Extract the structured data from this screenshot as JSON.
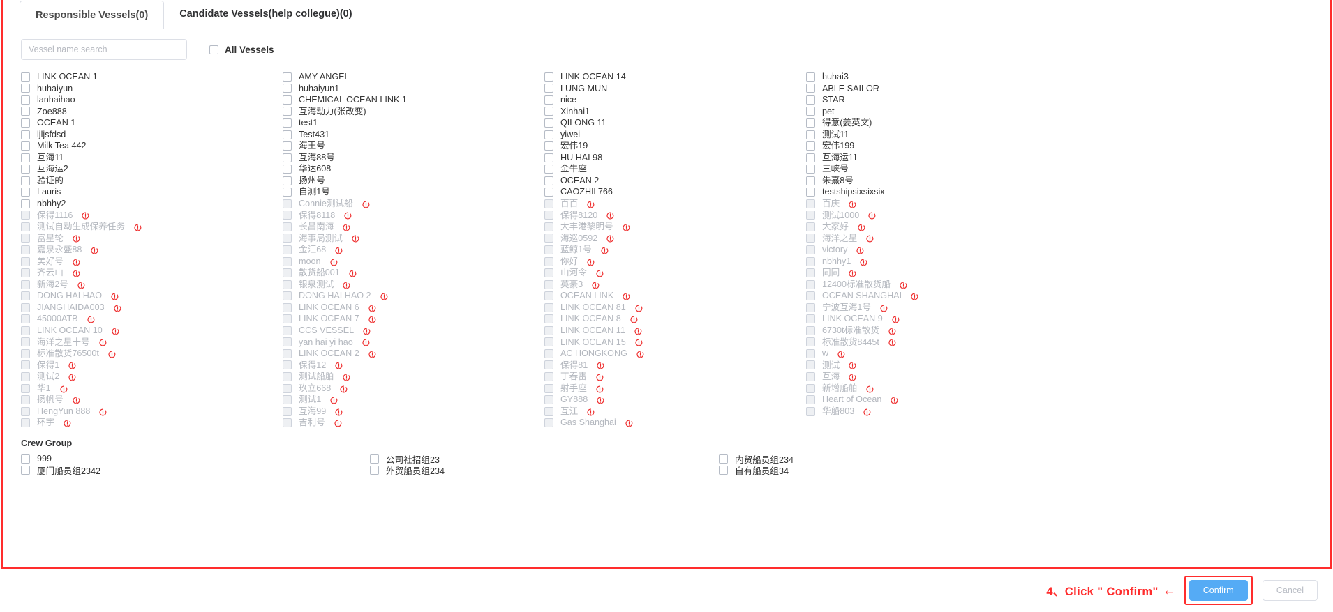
{
  "tabs": [
    {
      "label": "Responsible Vessels(0)",
      "active": true
    },
    {
      "label": "Candidate Vessels(help collegue)(0)",
      "active": false
    }
  ],
  "search": {
    "placeholder": "Vessel name search",
    "value": ""
  },
  "all_vessels": {
    "label": "All Vessels",
    "checked": false
  },
  "columns": [
    {
      "items": [
        {
          "label": "LINK OCEAN 1",
          "disabled": false,
          "warn": false
        },
        {
          "label": "huhaiyun",
          "disabled": false,
          "warn": false
        },
        {
          "label": "lanhaihao",
          "disabled": false,
          "warn": false
        },
        {
          "label": "Zoe888",
          "disabled": false,
          "warn": false
        },
        {
          "label": "OCEAN 1",
          "disabled": false,
          "warn": false
        },
        {
          "label": "ljljsfdsd",
          "disabled": false,
          "warn": false
        },
        {
          "label": "Milk Tea 442",
          "disabled": false,
          "warn": false
        },
        {
          "label": "互海11",
          "disabled": false,
          "warn": false
        },
        {
          "label": "互海运2",
          "disabled": false,
          "warn": false
        },
        {
          "label": "验证的",
          "disabled": false,
          "warn": false
        },
        {
          "label": "Lauris",
          "disabled": false,
          "warn": false
        },
        {
          "label": "nbhhy2",
          "disabled": false,
          "warn": false
        },
        {
          "label": "保得1116",
          "disabled": true,
          "warn": true
        },
        {
          "label": "测试自动生成保养任务",
          "disabled": true,
          "warn": true
        },
        {
          "label": "富星轮",
          "disabled": true,
          "warn": true
        },
        {
          "label": "嘉泉永盛88",
          "disabled": true,
          "warn": true
        },
        {
          "label": "美好号",
          "disabled": true,
          "warn": true
        },
        {
          "label": "齐云山",
          "disabled": true,
          "warn": true
        },
        {
          "label": "新海2号",
          "disabled": true,
          "warn": true
        },
        {
          "label": "DONG HAI HAO",
          "disabled": true,
          "warn": true
        },
        {
          "label": "JIANGHAIDA003",
          "disabled": true,
          "warn": true
        },
        {
          "label": "45000ATB",
          "disabled": true,
          "warn": true
        },
        {
          "label": "LINK OCEAN 10",
          "disabled": true,
          "warn": true
        },
        {
          "label": "海洋之星十号",
          "disabled": true,
          "warn": true
        },
        {
          "label": "标准散货76500t",
          "disabled": true,
          "warn": true
        },
        {
          "label": "保得1",
          "disabled": true,
          "warn": true
        },
        {
          "label": "测试2",
          "disabled": true,
          "warn": true
        },
        {
          "label": "华1",
          "disabled": true,
          "warn": true
        },
        {
          "label": "扬帆号",
          "disabled": true,
          "warn": true
        },
        {
          "label": "HengYun 888",
          "disabled": true,
          "warn": true
        },
        {
          "label": "环宇",
          "disabled": true,
          "warn": true
        }
      ]
    },
    {
      "items": [
        {
          "label": "AMY ANGEL",
          "disabled": false,
          "warn": false
        },
        {
          "label": "huhaiyun1",
          "disabled": false,
          "warn": false
        },
        {
          "label": "CHEMICAL OCEAN LINK 1",
          "disabled": false,
          "warn": false
        },
        {
          "label": "互海动力(张改变)",
          "disabled": false,
          "warn": false
        },
        {
          "label": "test1",
          "disabled": false,
          "warn": false
        },
        {
          "label": "Test431",
          "disabled": false,
          "warn": false
        },
        {
          "label": "海王号",
          "disabled": false,
          "warn": false
        },
        {
          "label": "互海88号",
          "disabled": false,
          "warn": false
        },
        {
          "label": "华达608",
          "disabled": false,
          "warn": false
        },
        {
          "label": "扬州号",
          "disabled": false,
          "warn": false
        },
        {
          "label": "自测1号",
          "disabled": false,
          "warn": false
        },
        {
          "label": "Connie测试船",
          "disabled": true,
          "warn": true
        },
        {
          "label": "保得8118",
          "disabled": true,
          "warn": true
        },
        {
          "label": "长昌南海",
          "disabled": true,
          "warn": true
        },
        {
          "label": "海事局测试",
          "disabled": true,
          "warn": true
        },
        {
          "label": "金汇68",
          "disabled": true,
          "warn": true
        },
        {
          "label": "moon",
          "disabled": true,
          "warn": true
        },
        {
          "label": "散货船001",
          "disabled": true,
          "warn": true
        },
        {
          "label": "银泉测试",
          "disabled": true,
          "warn": true
        },
        {
          "label": "DONG HAI HAO 2",
          "disabled": true,
          "warn": true
        },
        {
          "label": "LINK OCEAN 6",
          "disabled": true,
          "warn": true
        },
        {
          "label": "LINK OCEAN 7",
          "disabled": true,
          "warn": true
        },
        {
          "label": "CCS VESSEL",
          "disabled": true,
          "warn": true
        },
        {
          "label": "yan hai yi hao",
          "disabled": true,
          "warn": true
        },
        {
          "label": "LINK OCEAN 2",
          "disabled": true,
          "warn": true
        },
        {
          "label": "保得12",
          "disabled": true,
          "warn": true
        },
        {
          "label": "测试船舶",
          "disabled": true,
          "warn": true
        },
        {
          "label": "玖立668",
          "disabled": true,
          "warn": true
        },
        {
          "label": "测试1",
          "disabled": true,
          "warn": true
        },
        {
          "label": "互海99",
          "disabled": true,
          "warn": true
        },
        {
          "label": "吉利号",
          "disabled": true,
          "warn": true
        }
      ]
    },
    {
      "items": [
        {
          "label": "LINK OCEAN 14",
          "disabled": false,
          "warn": false
        },
        {
          "label": "LUNG MUN",
          "disabled": false,
          "warn": false
        },
        {
          "label": "nice",
          "disabled": false,
          "warn": false
        },
        {
          "label": "Xinhai1",
          "disabled": false,
          "warn": false
        },
        {
          "label": "QILONG 11",
          "disabled": false,
          "warn": false
        },
        {
          "label": "yiwei",
          "disabled": false,
          "warn": false
        },
        {
          "label": "宏伟19",
          "disabled": false,
          "warn": false
        },
        {
          "label": "HU HAI 98",
          "disabled": false,
          "warn": false
        },
        {
          "label": "金牛座",
          "disabled": false,
          "warn": false
        },
        {
          "label": "OCEAN 2",
          "disabled": false,
          "warn": false
        },
        {
          "label": "CAOZHIl 766",
          "disabled": false,
          "warn": false
        },
        {
          "label": "百百",
          "disabled": true,
          "warn": true
        },
        {
          "label": "保得8120",
          "disabled": true,
          "warn": true
        },
        {
          "label": "大丰港黎明号",
          "disabled": true,
          "warn": true
        },
        {
          "label": "海巡0592",
          "disabled": true,
          "warn": true
        },
        {
          "label": "蓝鲸1号",
          "disabled": true,
          "warn": true
        },
        {
          "label": "你好",
          "disabled": true,
          "warn": true
        },
        {
          "label": "山河令",
          "disabled": true,
          "warn": true
        },
        {
          "label": "英豪3",
          "disabled": true,
          "warn": true
        },
        {
          "label": "OCEAN LINK",
          "disabled": true,
          "warn": true
        },
        {
          "label": "LINK OCEAN 81",
          "disabled": true,
          "warn": true
        },
        {
          "label": "LINK OCEAN 8",
          "disabled": true,
          "warn": true
        },
        {
          "label": "LINK OCEAN 11",
          "disabled": true,
          "warn": true
        },
        {
          "label": "LINK OCEAN 15",
          "disabled": true,
          "warn": true
        },
        {
          "label": "AC HONGKONG",
          "disabled": true,
          "warn": true
        },
        {
          "label": "保得81",
          "disabled": true,
          "warn": true
        },
        {
          "label": "丁春雷",
          "disabled": true,
          "warn": true
        },
        {
          "label": "射手座",
          "disabled": true,
          "warn": true
        },
        {
          "label": "GY888",
          "disabled": true,
          "warn": true
        },
        {
          "label": "互江",
          "disabled": true,
          "warn": true
        },
        {
          "label": "Gas Shanghai",
          "disabled": true,
          "warn": true
        }
      ]
    },
    {
      "items": [
        {
          "label": "huhai3",
          "disabled": false,
          "warn": false
        },
        {
          "label": "ABLE SAILOR",
          "disabled": false,
          "warn": false
        },
        {
          "label": "STAR",
          "disabled": false,
          "warn": false
        },
        {
          "label": "pet",
          "disabled": false,
          "warn": false
        },
        {
          "label": "得意(姜英文)",
          "disabled": false,
          "warn": false
        },
        {
          "label": "测试11",
          "disabled": false,
          "warn": false
        },
        {
          "label": "宏伟199",
          "disabled": false,
          "warn": false
        },
        {
          "label": "互海运11",
          "disabled": false,
          "warn": false
        },
        {
          "label": "三峡号",
          "disabled": false,
          "warn": false
        },
        {
          "label": "朱熹8号",
          "disabled": false,
          "warn": false
        },
        {
          "label": "testshipsixsixsix",
          "disabled": false,
          "warn": false
        },
        {
          "label": "百庆",
          "disabled": true,
          "warn": true
        },
        {
          "label": "测试1000",
          "disabled": true,
          "warn": true
        },
        {
          "label": "大家好",
          "disabled": true,
          "warn": true
        },
        {
          "label": "海洋之星",
          "disabled": true,
          "warn": true
        },
        {
          "label": "victory",
          "disabled": true,
          "warn": true
        },
        {
          "label": "nbhhy1",
          "disabled": true,
          "warn": true
        },
        {
          "label": "同同",
          "disabled": true,
          "warn": true
        },
        {
          "label": "12400标准散货船",
          "disabled": true,
          "warn": true
        },
        {
          "label": "OCEAN SHANGHAI",
          "disabled": true,
          "warn": true
        },
        {
          "label": "宁波互海1号",
          "disabled": true,
          "warn": true
        },
        {
          "label": "LINK OCEAN 9",
          "disabled": true,
          "warn": true
        },
        {
          "label": "6730t标准散货",
          "disabled": true,
          "warn": true
        },
        {
          "label": "标准散货8445t",
          "disabled": true,
          "warn": true
        },
        {
          "label": "w",
          "disabled": true,
          "warn": true
        },
        {
          "label": "测试",
          "disabled": true,
          "warn": true
        },
        {
          "label": "互海",
          "disabled": true,
          "warn": true
        },
        {
          "label": "新增船舶",
          "disabled": true,
          "warn": true
        },
        {
          "label": "Heart of Ocean",
          "disabled": true,
          "warn": true
        },
        {
          "label": "华船803",
          "disabled": true,
          "warn": true
        }
      ]
    }
  ],
  "crew_group": {
    "title": "Crew Group",
    "columns": [
      {
        "items": [
          {
            "label": "999"
          },
          {
            "label": "厦门船员组2342"
          }
        ]
      },
      {
        "items": [
          {
            "label": "公司社招组23"
          },
          {
            "label": "外贸船员组234"
          }
        ]
      },
      {
        "items": [
          {
            "label": "内贸船员组234"
          },
          {
            "label": "自有船员组34"
          }
        ]
      }
    ]
  },
  "footer": {
    "annotation": "4、Click \" Confirm\"",
    "arrow": "←",
    "confirm_label": "Confirm",
    "cancel_label": "Cancel"
  },
  "colors": {
    "accent": "#55abf5",
    "highlight": "#ff2d2d",
    "disabled_text": "#b4b8bf",
    "border": "#dcdfe6"
  }
}
